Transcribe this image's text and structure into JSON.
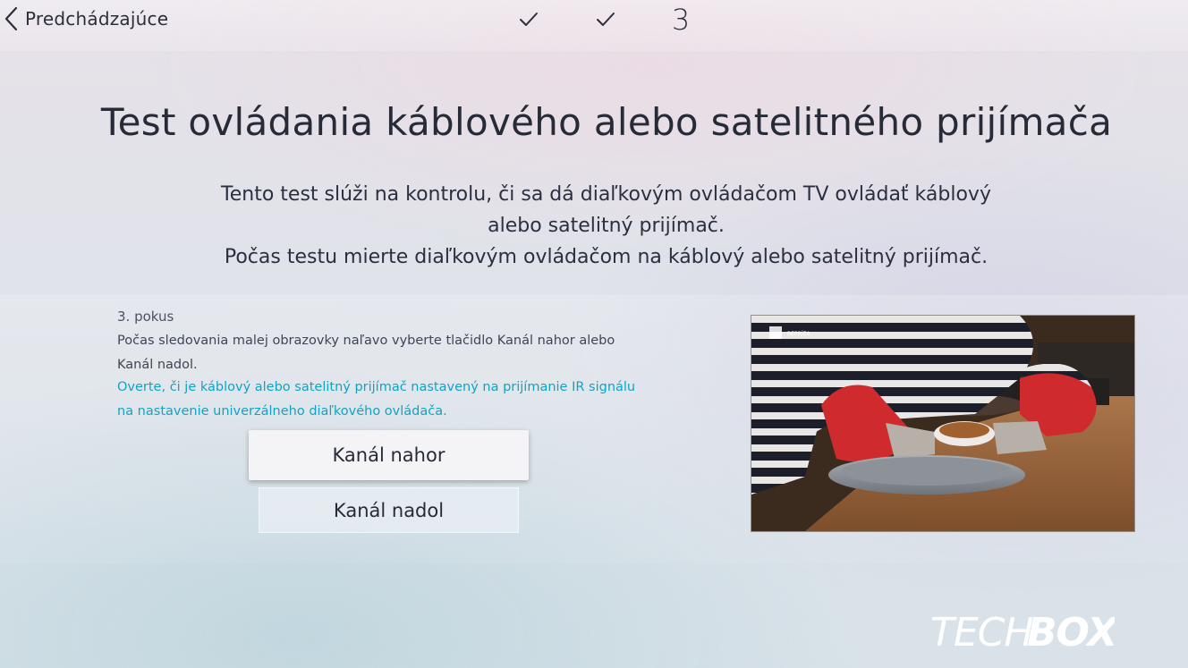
{
  "header": {
    "back_label": "Predchádzajúce",
    "steps": [
      {
        "state": "done",
        "icon": "checkmark-icon"
      },
      {
        "state": "done",
        "icon": "checkmark-icon"
      },
      {
        "state": "current",
        "label": "3"
      }
    ]
  },
  "title": "Test ovládania káblového alebo satelitného prijímača",
  "description": {
    "line1": "Tento test slúži na kontrolu, či sa dá diaľkovým ovládačom TV ovládať káblový alebo satelitný prijímač.",
    "line2": "Počas testu mierte diaľkovým ovládačom na káblový alebo satelitný prijímač."
  },
  "attempt": {
    "label": "3. pokus",
    "instruction": "Počas sledovania malej obrazovky naľavo vyberte tlačidlo Kanál nahor alebo Kanál nadol.",
    "hint": "Overte, či je káblový alebo satelitný prijímač nastavený na prijímanie IR signálu na nastavenie univerzálneho diaľkového ovládača."
  },
  "buttons": {
    "channel_up": "Kanál nahor",
    "channel_down": "Kanál nadol"
  },
  "preview": {
    "channel_logo": "REPRÍZA"
  },
  "watermark": "TECHBOX",
  "colors": {
    "hint_text": "#10a4c4",
    "focused_button": "#f4f4f6"
  }
}
